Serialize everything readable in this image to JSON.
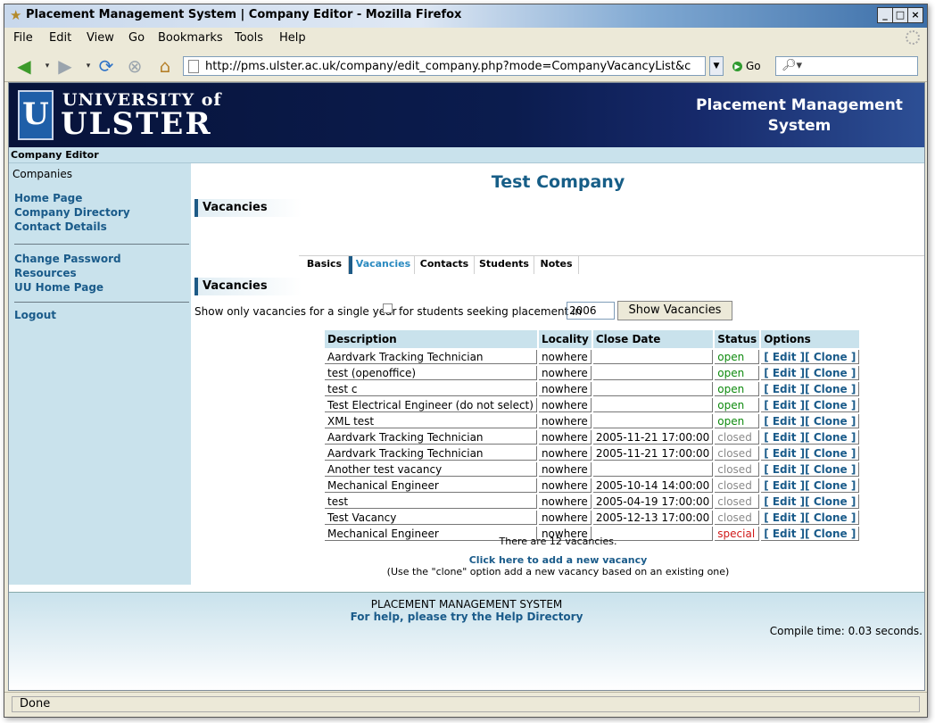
{
  "window": {
    "title": "Placement Management System | Company Editor - Mozilla Firefox"
  },
  "menu": [
    "File",
    "Edit",
    "View",
    "Go",
    "Bookmarks",
    "Tools",
    "Help"
  ],
  "toolbar": {
    "url": "http://pms.ulster.ac.uk/company/edit_company.php?mode=CompanyVacancyList&c",
    "go_label": "Go"
  },
  "banner": {
    "logo_letter": "U",
    "logo_line1": "UNIVERSITY of",
    "logo_line2": "ULSTER",
    "title_line1": "Placement Management",
    "title_line2": "System"
  },
  "breadcrumb": "Company Editor",
  "sidebar": {
    "heading": "Companies",
    "links_group1": [
      "Home Page",
      "Company Directory",
      "Contact Details"
    ],
    "links_group2": [
      "Change Password",
      "Resources",
      "UU Home Page"
    ],
    "links_group3": [
      "Logout"
    ]
  },
  "main": {
    "company_name": "Test Company",
    "section1": "Vacancies",
    "section2": "Vacancies",
    "tabs": [
      "Basics",
      "Vacancies",
      "Contacts",
      "Students",
      "Notes"
    ],
    "active_tab": "Vacancies",
    "filter_label1": "Show only vacancies for a single year",
    "filter_label2": "for students seeking placement in",
    "year_value": "2006",
    "show_button": "Show Vacancies",
    "table": {
      "headers": [
        "Description",
        "Locality",
        "Close Date",
        "Status",
        "Options"
      ],
      "edit_label": "[ Edit ]",
      "clone_label": "[ Clone ]",
      "rows": [
        {
          "description": "Aardvark Tracking Technician",
          "locality": "nowhere",
          "close_date": "",
          "status": "open"
        },
        {
          "description": "test (openoffice)",
          "locality": "nowhere",
          "close_date": "",
          "status": "open"
        },
        {
          "description": "test c",
          "locality": "nowhere",
          "close_date": "",
          "status": "open"
        },
        {
          "description": "Test Electrical Engineer (do not select)",
          "locality": "nowhere",
          "close_date": "",
          "status": "open"
        },
        {
          "description": "XML test",
          "locality": "nowhere",
          "close_date": "",
          "status": "open"
        },
        {
          "description": "Aardvark Tracking Technician",
          "locality": "nowhere",
          "close_date": "2005-11-21 17:00:00",
          "status": "closed"
        },
        {
          "description": "Aardvark Tracking Technician",
          "locality": "nowhere",
          "close_date": "2005-11-21 17:00:00",
          "status": "closed"
        },
        {
          "description": "Another test vacancy",
          "locality": "nowhere",
          "close_date": "",
          "status": "closed"
        },
        {
          "description": "Mechanical Engineer",
          "locality": "nowhere",
          "close_date": "2005-10-14 14:00:00",
          "status": "closed"
        },
        {
          "description": "test",
          "locality": "nowhere",
          "close_date": "2005-04-19 17:00:00",
          "status": "closed"
        },
        {
          "description": "Test Vacancy",
          "locality": "nowhere",
          "close_date": "2005-12-13 17:00:00",
          "status": "closed"
        },
        {
          "description": "Mechanical Engineer",
          "locality": "nowhere",
          "close_date": "",
          "status": "special"
        }
      ]
    },
    "count_text": "There are 12 vacancies.",
    "add_link": "Click here to add a new vacancy",
    "add_note": "(Use the \"clone\" option add a new vacancy based on an existing one)"
  },
  "footer": {
    "line1": "PLACEMENT MANAGEMENT SYSTEM",
    "line2": "For help, please try the Help Directory",
    "compile": "Compile time: 0.03 seconds."
  },
  "status_bar": "Done",
  "colors": {
    "status_open": "#0e8a0e",
    "status_closed": "#8a8a8a",
    "status_special": "#d01818",
    "link": "#1a5b8a",
    "accent": "#175e87"
  }
}
